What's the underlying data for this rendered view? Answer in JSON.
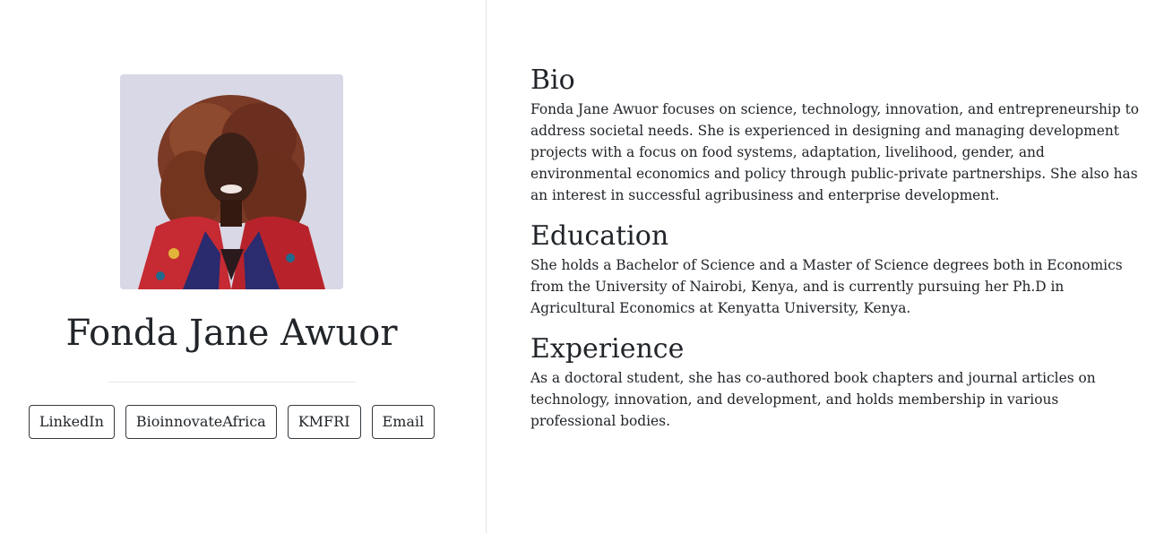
{
  "profile": {
    "name": "Fonda Jane Awuor",
    "photo_alt": "Fonda Jane Awuor",
    "links": [
      {
        "label": "LinkedIn"
      },
      {
        "label": "BioinnovateAfrica"
      },
      {
        "label": "KMFRI"
      },
      {
        "label": "Email"
      }
    ]
  },
  "sections": {
    "bio": {
      "heading": "Bio",
      "text": "Fonda Jane Awuor focuses on science, technology, innovation, and entrepreneurship to address societal needs. She is experienced in designing and managing development projects with a focus on food systems, adaptation, livelihood, gender, and environmental economics and policy through public-private partnerships. She also has an interest in successful agribusiness and enterprise development."
    },
    "education": {
      "heading": "Education",
      "text": "She holds a Bachelor of Science and a Master of Science degrees both in Economics from the University of Nairobi, Kenya, and is currently pursuing her Ph.D in Agricultural Economics at Kenyatta University, Kenya."
    },
    "experience": {
      "heading": "Experience",
      "text": "As a doctoral student, she has co-authored book chapters and journal articles on technology, innovation, and development, and holds membership in various professional bodies."
    }
  },
  "colors": {
    "text": "#212529",
    "divider": "#e3e3e3",
    "button_border": "#343a40",
    "photo_background": "#d9d8e6"
  }
}
